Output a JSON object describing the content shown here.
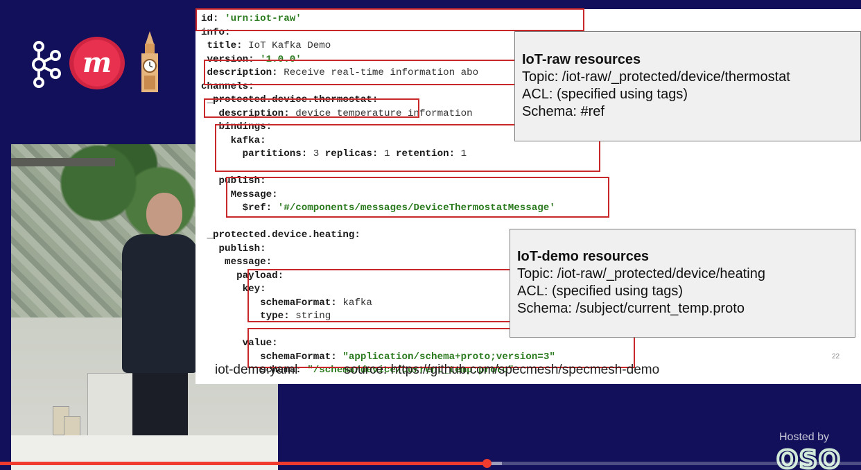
{
  "code_lines": [
    [
      {
        "t": "id: ",
        "c": "k"
      },
      {
        "t": "'urn:iot-raw'",
        "c": "s"
      }
    ],
    [
      {
        "t": "info:",
        "c": "k"
      }
    ],
    [
      {
        "t": " title: ",
        "c": "k"
      },
      {
        "t": "IoT Kafka Demo",
        "c": "v"
      }
    ],
    [
      {
        "t": " version: ",
        "c": "k"
      },
      {
        "t": "'1.0.0'",
        "c": "s"
      }
    ],
    [
      {
        "t": " description: ",
        "c": "k"
      },
      {
        "t": "Receive real-time information abo",
        "c": "v"
      }
    ],
    [
      {
        "t": "channels:",
        "c": "k"
      }
    ],
    [
      {
        "t": " _protected.device.thermostat:",
        "c": "k"
      }
    ],
    [
      {
        "t": "   description: ",
        "c": "k"
      },
      {
        "t": "device temperature information",
        "c": "v"
      }
    ],
    [
      {
        "t": "   bindings:",
        "c": "k"
      }
    ],
    [
      {
        "t": "     kafka:",
        "c": "k"
      }
    ],
    [
      {
        "t": "       partitions: ",
        "c": "k"
      },
      {
        "t": "3 ",
        "c": "v"
      },
      {
        "t": "replicas: ",
        "c": "k"
      },
      {
        "t": "1 ",
        "c": "v"
      },
      {
        "t": "retention: ",
        "c": "k"
      },
      {
        "t": "1",
        "c": "v"
      }
    ],
    [],
    [
      {
        "t": "   publish:",
        "c": "k"
      }
    ],
    [
      {
        "t": "     Message:",
        "c": "k"
      }
    ],
    [
      {
        "t": "       $ref: ",
        "c": "k"
      },
      {
        "t": "'#/components/messages/DeviceThermostatMessage'",
        "c": "s"
      }
    ],
    [],
    [
      {
        "t": " _protected.device.heating:",
        "c": "k"
      }
    ],
    [
      {
        "t": "   publish:",
        "c": "k"
      }
    ],
    [
      {
        "t": "    message:",
        "c": "k"
      }
    ],
    [
      {
        "t": "      payload:",
        "c": "k"
      }
    ],
    [
      {
        "t": "       key:",
        "c": "k"
      }
    ],
    [
      {
        "t": "          schemaFormat: ",
        "c": "k"
      },
      {
        "t": "kafka",
        "c": "v"
      }
    ],
    [
      {
        "t": "          type: ",
        "c": "k"
      },
      {
        "t": "string",
        "c": "v"
      }
    ],
    [],
    [
      {
        "t": "       value:",
        "c": "k"
      }
    ],
    [
      {
        "t": "          schemaFormat: ",
        "c": "k"
      },
      {
        "t": "\"application/schema+proto;version=3\"",
        "c": "s"
      }
    ],
    [
      {
        "t": "          schema: ",
        "c": "k"
      },
      {
        "t": "\"/schema/device/current_temp.proto\"",
        "c": "s"
      }
    ]
  ],
  "callout_raw": {
    "title": "IoT-raw resources",
    "topic": "Topic: /iot-raw/_protected/device/thermostat",
    "acl": "ACL: (specified using tags)",
    "schema": "Schema: #ref"
  },
  "callout_demo": {
    "title": "IoT-demo resources",
    "topic": "Topic: /iot-raw/_protected/device/heating",
    "acl": "ACL: (specified using tags)",
    "schema": "Schema: /subject/current_temp.proto"
  },
  "footer": {
    "file": "iot-demo.yaml",
    "source": "source: https://github.com/specmesh/specmesh-demo"
  },
  "slide_number": "22",
  "hosted_by": "Hosted by",
  "sponsor_logo": "OSO",
  "meetup_glyph": "m",
  "colors": {
    "background": "#12105a",
    "highlight_box": "#c8282a",
    "string_value": "#2a7a1e",
    "progress": "#f03c2e"
  },
  "video": {
    "played_fraction": 0.565,
    "buffered_fraction": 0.583
  }
}
